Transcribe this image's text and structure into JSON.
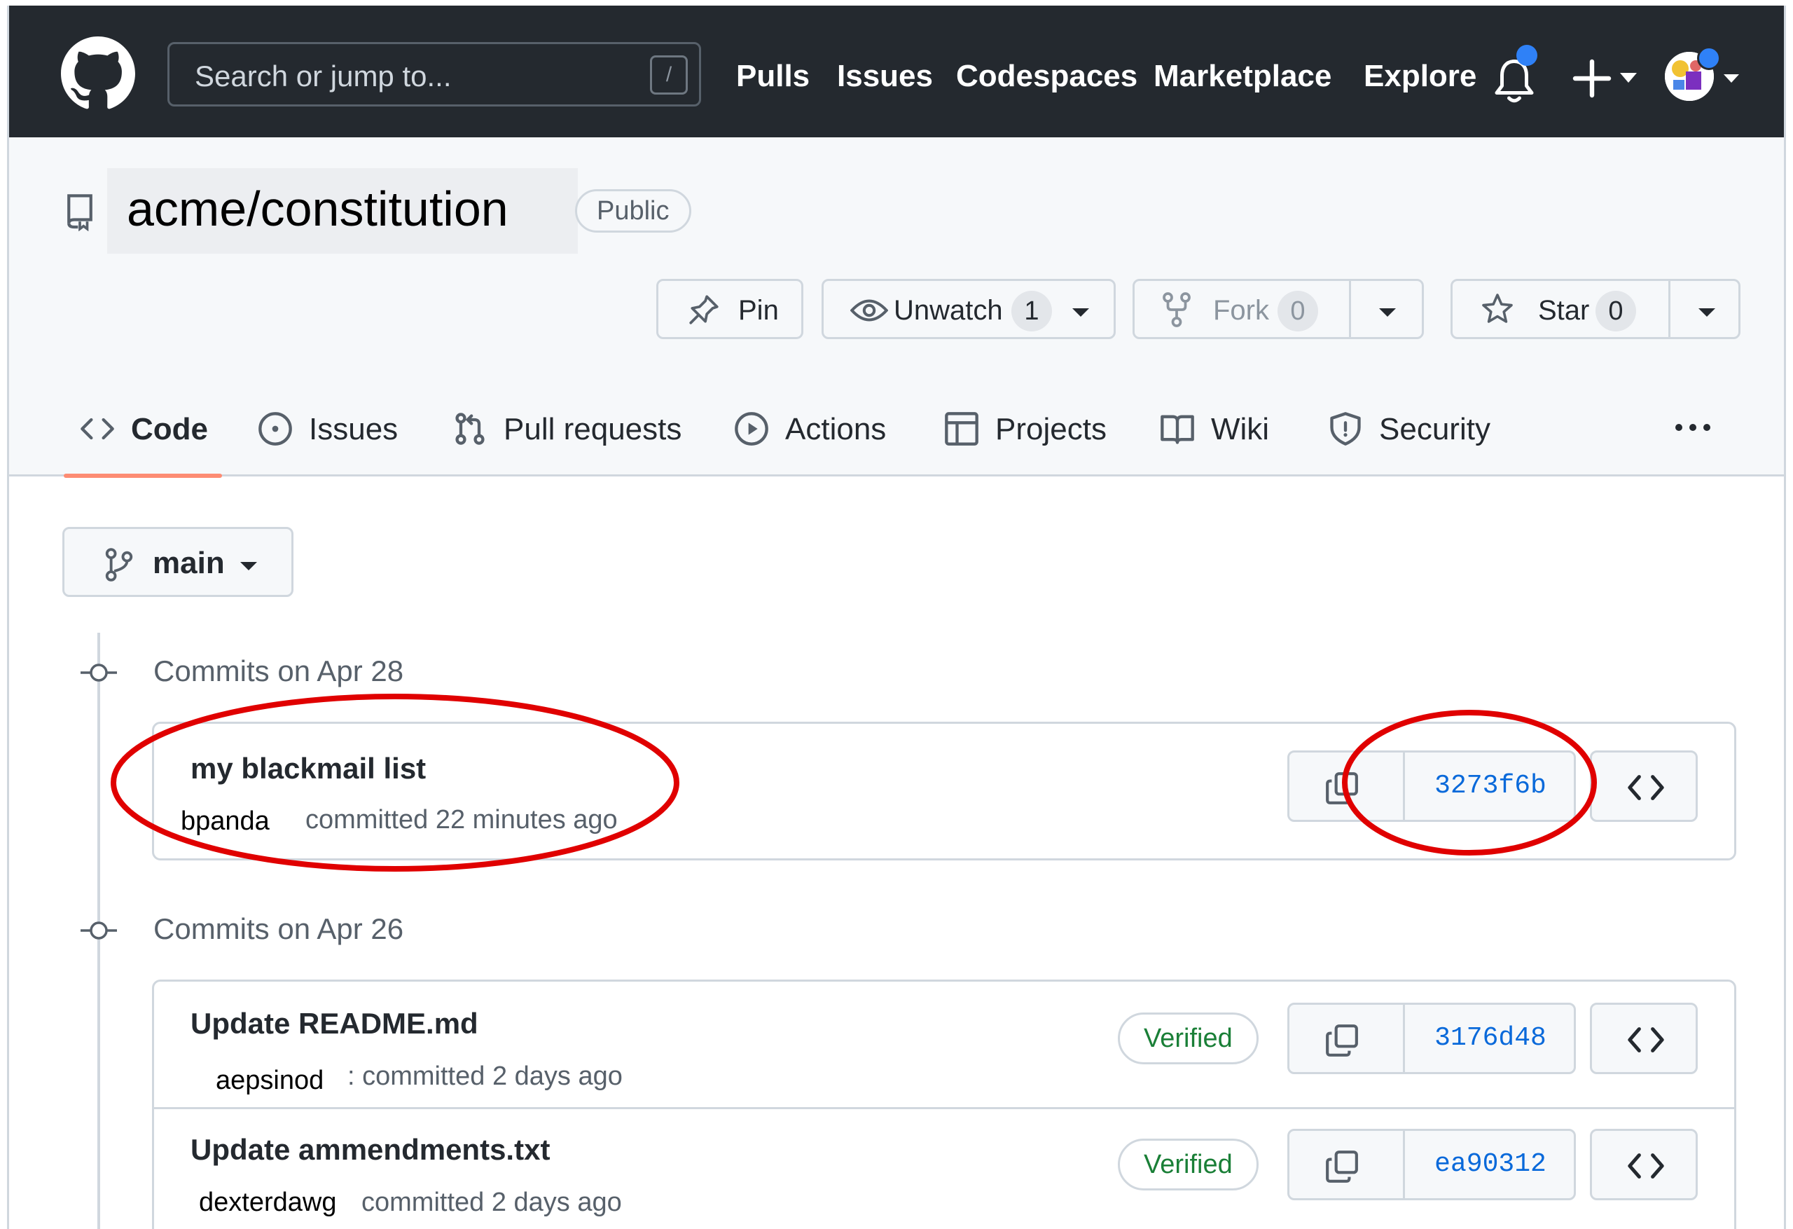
{
  "header": {
    "search_placeholder": "Search or jump to...",
    "search_shortcut": "/",
    "nav": [
      "Pulls",
      "Issues",
      "Codespaces",
      "Marketplace",
      "Explore"
    ]
  },
  "repo": {
    "full_name": "acme/constitution",
    "visibility": "Public",
    "pin_label": "Pin",
    "unwatch_label": "Unwatch",
    "watch_count": "1",
    "fork_label": "Fork",
    "fork_count": "0",
    "star_label": "Star",
    "star_count": "0"
  },
  "tabs": [
    {
      "label": "Code",
      "icon": "code-icon",
      "selected": true
    },
    {
      "label": "Issues",
      "icon": "issue-icon"
    },
    {
      "label": "Pull requests",
      "icon": "pull-request-icon"
    },
    {
      "label": "Actions",
      "icon": "play-icon"
    },
    {
      "label": "Projects",
      "icon": "table-icon"
    },
    {
      "label": "Wiki",
      "icon": "book-icon"
    },
    {
      "label": "Security",
      "icon": "shield-icon"
    }
  ],
  "branch": {
    "name": "main"
  },
  "commit_groups": [
    {
      "date_label": "Commits on Apr 28",
      "commits": [
        {
          "message": "my blackmail list",
          "author": "bpanda",
          "meta": "committed 22 minutes ago",
          "verified": false,
          "sha": "3273f6b"
        }
      ]
    },
    {
      "date_label": "Commits on Apr 26",
      "commits": [
        {
          "message": "Update README.md",
          "author": "aepsinod",
          "meta": ": committed 2 days ago",
          "verified": true,
          "verified_label": "Verified",
          "sha": "3176d48"
        },
        {
          "message": "Update ammendments.txt",
          "author": "dexterdawg",
          "meta": "committed 2 days ago",
          "verified": true,
          "verified_label": "Verified",
          "sha": "ea90312"
        }
      ]
    }
  ],
  "colors": {
    "header_bg": "#24292f",
    "link_blue": "#0969da",
    "verified_green": "#1a7f37",
    "tab_underline": "#fd8c73",
    "annotation_red": "#e00000"
  }
}
